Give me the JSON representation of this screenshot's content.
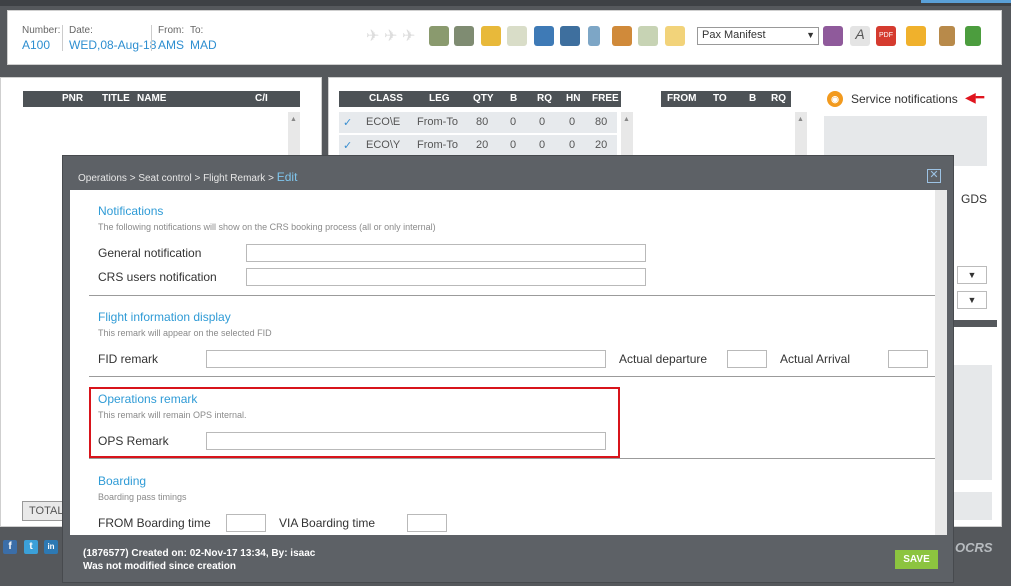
{
  "flight": {
    "number_label": "Number:",
    "number": "A100",
    "date_label": "Date:",
    "date": "WED,08-Aug-18",
    "from_label": "From:",
    "from": "AMS",
    "to_label": "To:",
    "to": "MAD"
  },
  "toolbar": {
    "icons": [
      "plane-icon",
      "plane-icon",
      "plane-icon",
      "add-list-icon",
      "list-icon",
      "pencil-icon",
      "document-edit-icon",
      "users-icon",
      "user-search-icon",
      "mobile-icon",
      "agent-icon",
      "check-document-icon",
      "note-icon",
      "printer-icon",
      "font-icon",
      "pdf-icon",
      "mail-icon",
      "clipboard-icon",
      "refresh-icon"
    ],
    "report_select": "Pax Manifest"
  },
  "pax_table": {
    "headers": [
      "PNR",
      "TITLE",
      "NAME",
      "C/I"
    ],
    "total_label": "TOTAL"
  },
  "class_table": {
    "headers": [
      "CLASS",
      "LEG",
      "QTY",
      "B",
      "RQ",
      "HN",
      "FREE"
    ],
    "rows": [
      {
        "class": "ECO\\E",
        "leg": "From-To",
        "qty": "80",
        "b": "0",
        "rq": "0",
        "hn": "0",
        "free": "80"
      },
      {
        "class": "ECO\\Y",
        "leg": "From-To",
        "qty": "20",
        "b": "0",
        "rq": "0",
        "hn": "0",
        "free": "20"
      }
    ]
  },
  "leg_table": {
    "headers": [
      "FROM",
      "TO",
      "B",
      "RQ"
    ]
  },
  "service_notifications": "Service notifications",
  "gds_label": "GDS",
  "modal": {
    "breadcrumb": "Operations > Seat control > Flight Remark > ",
    "breadcrumb_current": "Edit",
    "notifications": {
      "title": "Notifications",
      "subtitle": "The following notifications will show on the CRS booking process (all or only internal)",
      "general_label": "General notification",
      "general_value": "",
      "crs_label": "CRS users notification",
      "crs_value": ""
    },
    "fid": {
      "title": "Flight information display",
      "subtitle": "This remark will appear on the selected FID",
      "remark_label": "FID remark",
      "remark_value": "",
      "departure_label": "Actual departure",
      "departure_value": "",
      "arrival_label": "Actual Arrival",
      "arrival_value": ""
    },
    "operations": {
      "title": "Operations remark",
      "subtitle": "This remark will remain OPS internal.",
      "remark_label": "OPS Remark",
      "remark_value": ""
    },
    "boarding": {
      "title": "Boarding",
      "subtitle": "Boarding pass timings",
      "from_label": "FROM Boarding time",
      "from_value": "",
      "via_label": "VIA Boarding time",
      "via_value": ""
    },
    "footer_line1": "(1876577) Created on: 02-Nov-17 13:34, By: isaac",
    "footer_line2": "Was not modified since creation",
    "save_label": "SAVE"
  },
  "social": [
    "f",
    "t",
    "in"
  ],
  "brand": "OCRS"
}
